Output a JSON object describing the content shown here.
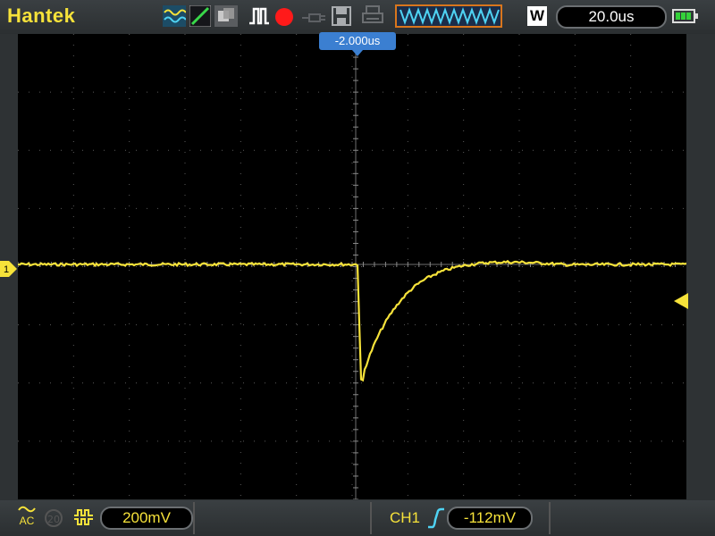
{
  "header": {
    "brand": "Hantek",
    "timebase": "20.0us",
    "trigger_position": "-2.000us",
    "mode_label": "W"
  },
  "footer": {
    "coupling": "AC",
    "bw_limit": "20",
    "volts_per_div": "200mV",
    "trigger_source": "CH1",
    "trigger_level": "-112mV"
  },
  "colors": {
    "trace": "#f6e23a",
    "accent_blue": "#3b7fd1",
    "record": "#ff1a1a"
  },
  "icons": [
    "waveform-icon",
    "line-icon",
    "persist-icon",
    "pulse-icon",
    "record-icon",
    "probe-icon",
    "save-icon",
    "print-icon",
    "battery-icon"
  ]
}
